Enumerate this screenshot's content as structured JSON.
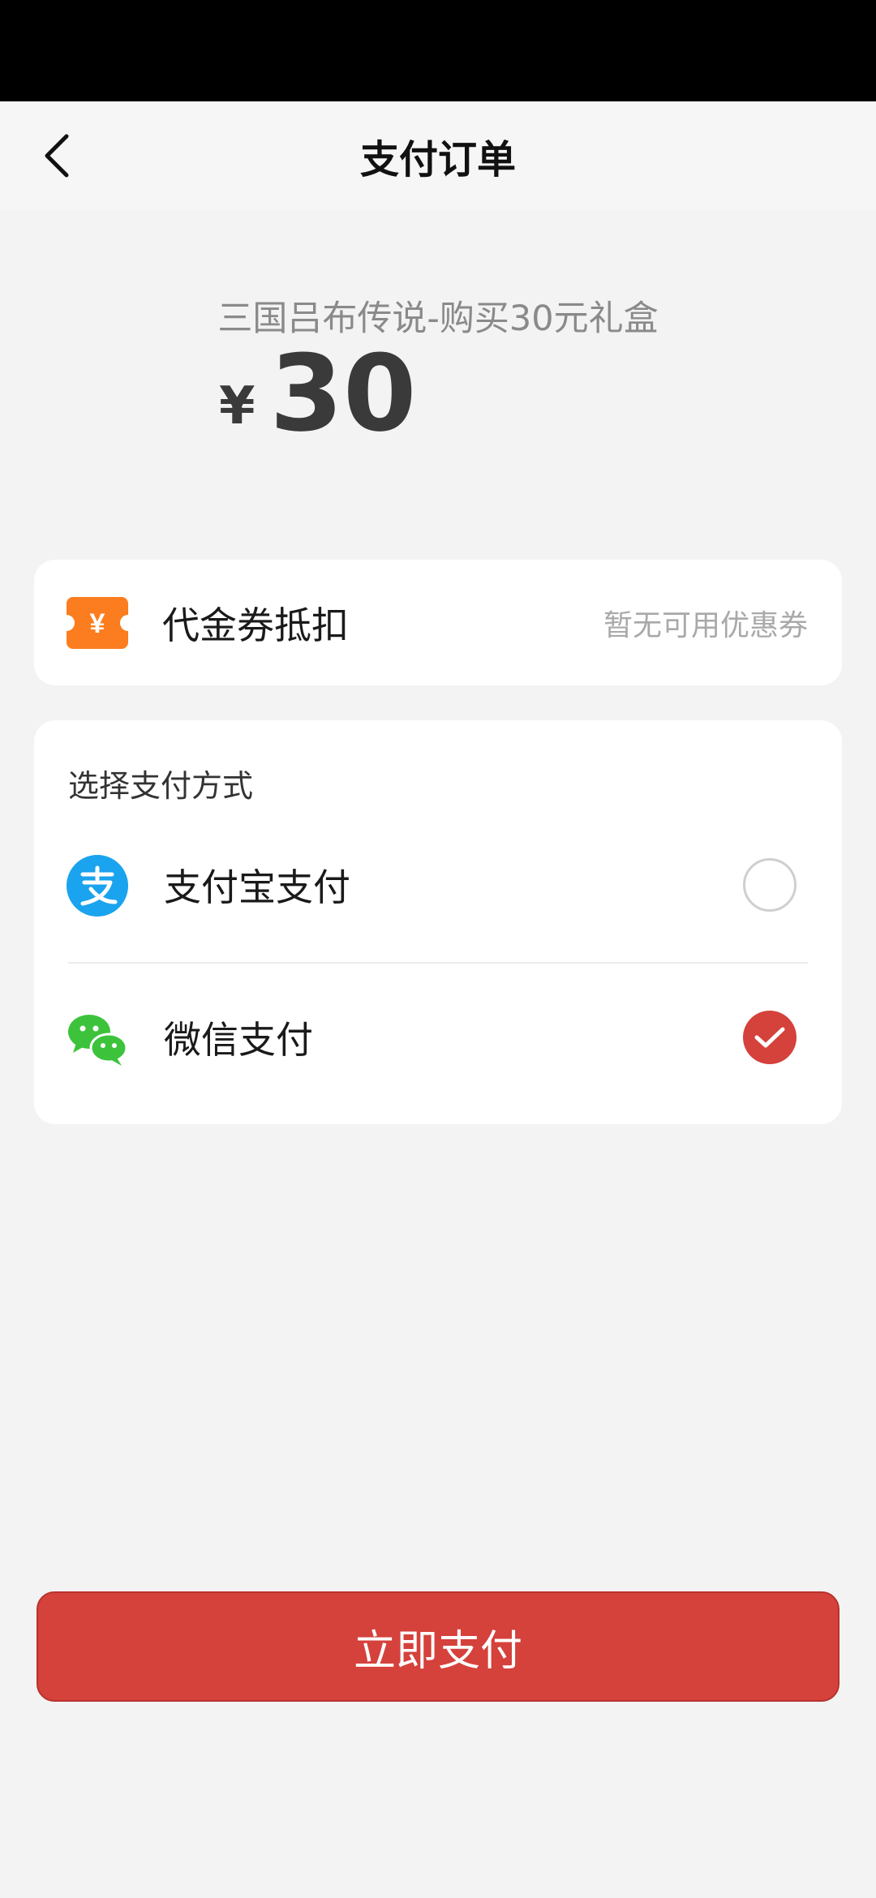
{
  "nav": {
    "title": "支付订单"
  },
  "order": {
    "product_name": "三国吕布传说-购买30元礼盒",
    "currency_symbol": "¥",
    "amount": "30"
  },
  "coupon": {
    "label": "代金券抵扣",
    "status": "暂无可用优惠券",
    "icon": "coupon-ticket-icon",
    "icon_symbol": "¥",
    "icon_color": "#fb7d1f"
  },
  "payment": {
    "heading": "选择支付方式",
    "methods": [
      {
        "label": "支付宝支付",
        "icon": "alipay-icon",
        "selected": false,
        "color": "#1aa3ee"
      },
      {
        "label": "微信支付",
        "icon": "wechat-icon",
        "selected": true,
        "color": "#3cc33b"
      }
    ]
  },
  "actions": {
    "pay_label": "立即支付",
    "accent_color": "#d5413b"
  }
}
